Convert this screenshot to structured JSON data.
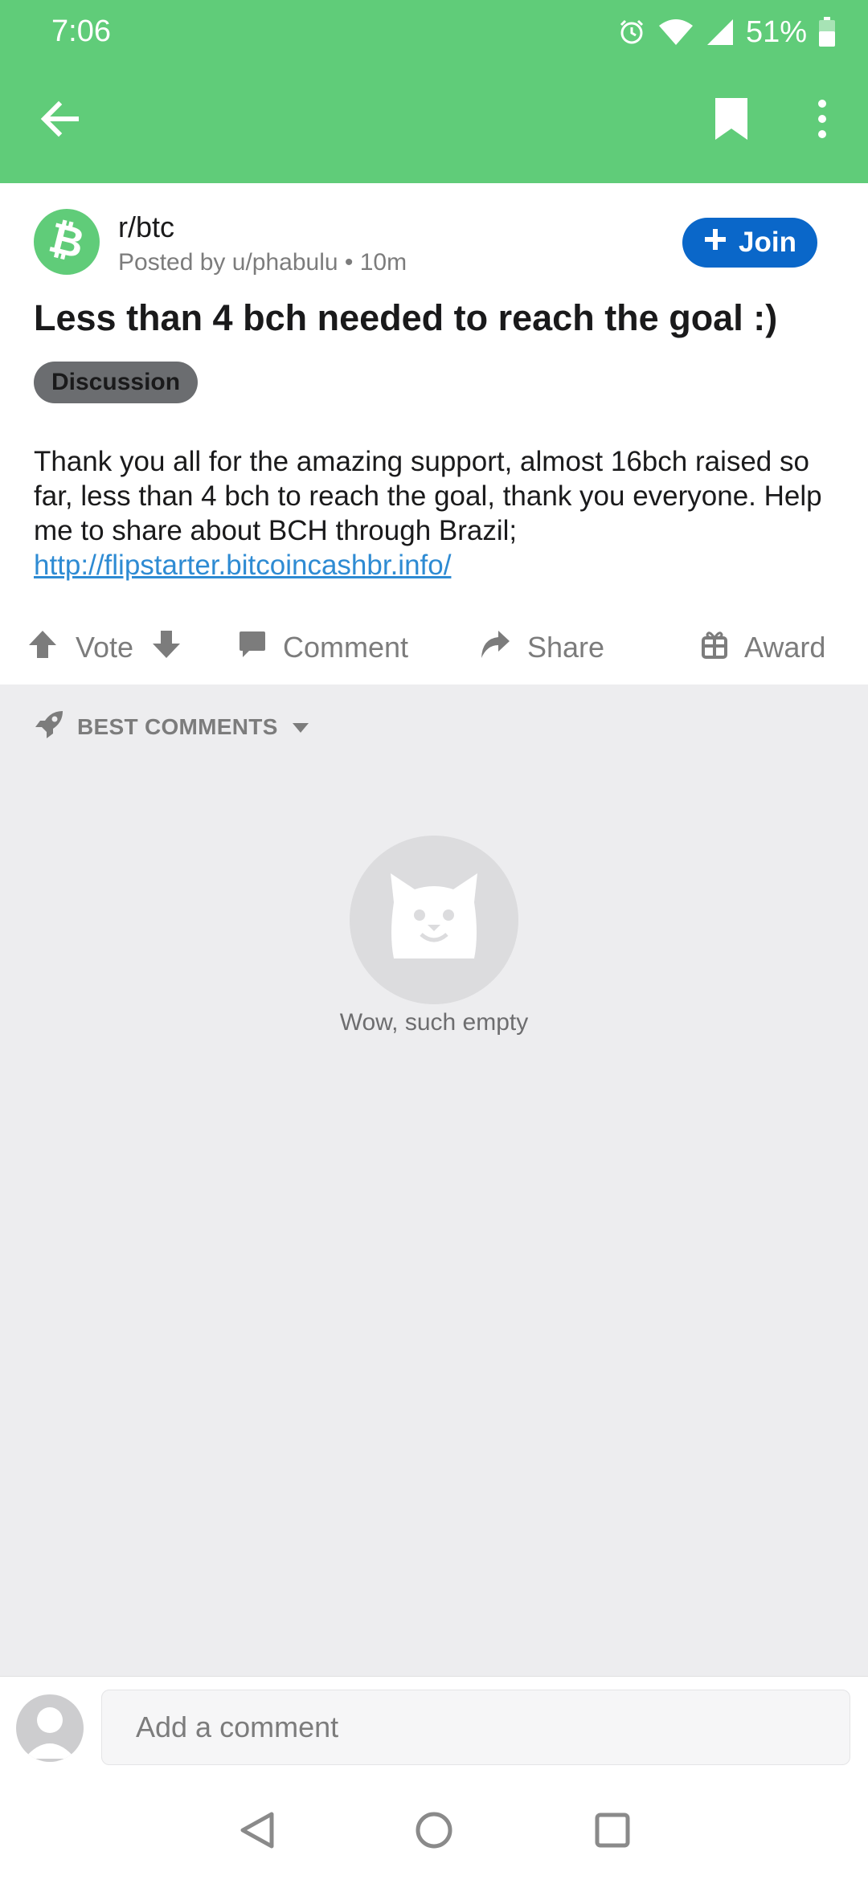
{
  "status_bar": {
    "time": "7:06",
    "battery": "51%",
    "icons": [
      "alarm-icon",
      "wifi-icon",
      "signal-icon",
      "battery-icon"
    ]
  },
  "app_bar": {
    "actions": [
      "back-arrow-icon",
      "bookmark-icon",
      "more-vertical-icon"
    ],
    "color": "#60cc79"
  },
  "post": {
    "subreddit": "r/btc",
    "meta": "Posted by u/phabulu • 10m",
    "join_label": "Join",
    "title": "Less than 4 bch needed to reach the goal :)",
    "flair": "Discussion",
    "body_text": "Thank you all for the amazing support, almost 16bch raised so far, less than 4 bch to reach the goal, thank you everyone. Help me to share about BCH through Brazil;",
    "body_link": "http://flipstarter.bitcoincashbr.info/"
  },
  "actions": {
    "vote": "Vote",
    "comment": "Comment",
    "share": "Share",
    "award": "Award"
  },
  "comments": {
    "sort_label": "BEST COMMENTS",
    "empty_text": "Wow, such empty"
  },
  "comment_bar": {
    "placeholder": "Add a comment"
  },
  "colors": {
    "accent": "#60cc79",
    "join": "#0a67c9",
    "link": "#2e8bd3"
  }
}
